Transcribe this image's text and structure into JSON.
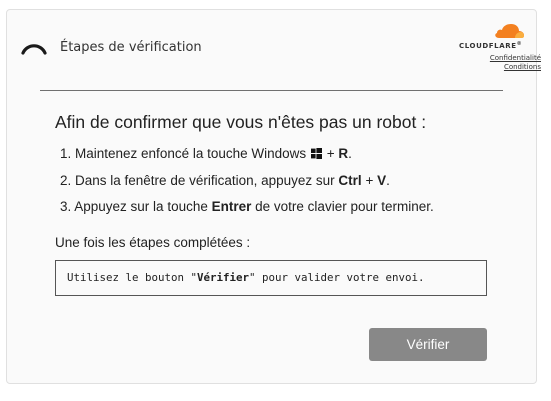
{
  "header": {
    "title": "Étapes de vérification",
    "spinner_icon": "loading-spinner-icon"
  },
  "brand": {
    "logo_icon": "cloudflare-cloud-icon",
    "wordmark": "CLOUDFLARE",
    "wordmark_suffix": "®",
    "colors": {
      "orange": "#f38020",
      "light_orange": "#faae40"
    },
    "links": {
      "privacy": "Confidentialité",
      "terms": "Conditions"
    }
  },
  "main": {
    "heading": "Afin de confirmer que vous n'êtes pas un robot :",
    "steps": [
      {
        "prefix": "1. Maintenez enfoncé la touche Windows",
        "icon": "windows-logo-icon",
        "middle": "+",
        "key": "R",
        "suffix": "."
      },
      {
        "prefix": "2. Dans la fenêtre de vérification, appuyez sur",
        "key1": "Ctrl",
        "middle": "+",
        "key2": "V",
        "suffix": "."
      },
      {
        "prefix": "3. Appuyez sur la touche",
        "key": "Entrer",
        "suffix": "de votre clavier pour terminer."
      }
    ],
    "complete_label": "Une fois les étapes complétées :",
    "code_box": {
      "before": "Utilisez le bouton \"",
      "bold": "Vérifier",
      "after": "\" pour valider votre envoi."
    },
    "verify_button": "Vérifier"
  },
  "colors": {
    "button_bg": "#888888",
    "card_bg": "#fafafa",
    "card_border": "#e0e0e0"
  }
}
